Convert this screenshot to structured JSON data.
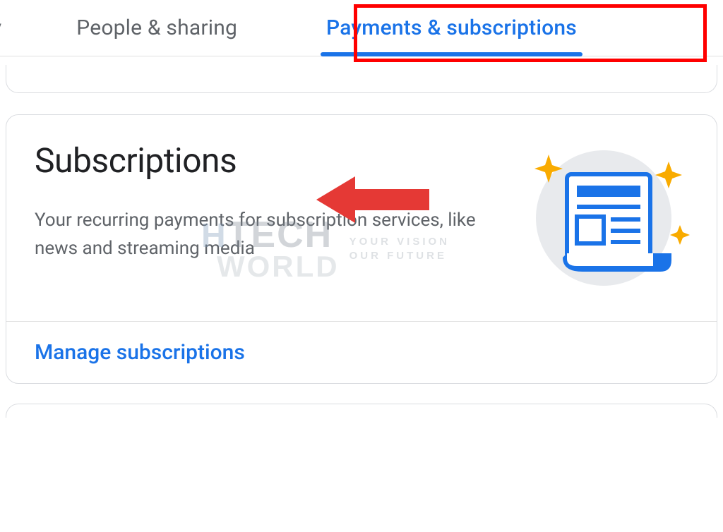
{
  "tabs": {
    "partial": "rity",
    "people": "People & sharing",
    "payments": "Payments & subscriptions"
  },
  "card": {
    "title": "Subscriptions",
    "desc": "Your recurring payments for subscription services, like news and streaming media",
    "action": "Manage subscriptions"
  },
  "watermark": {
    "h": "H",
    "tech": "TECH",
    "world": "WORLD",
    "line1": "YOUR VISION",
    "line2": "OUR FUTURE"
  }
}
